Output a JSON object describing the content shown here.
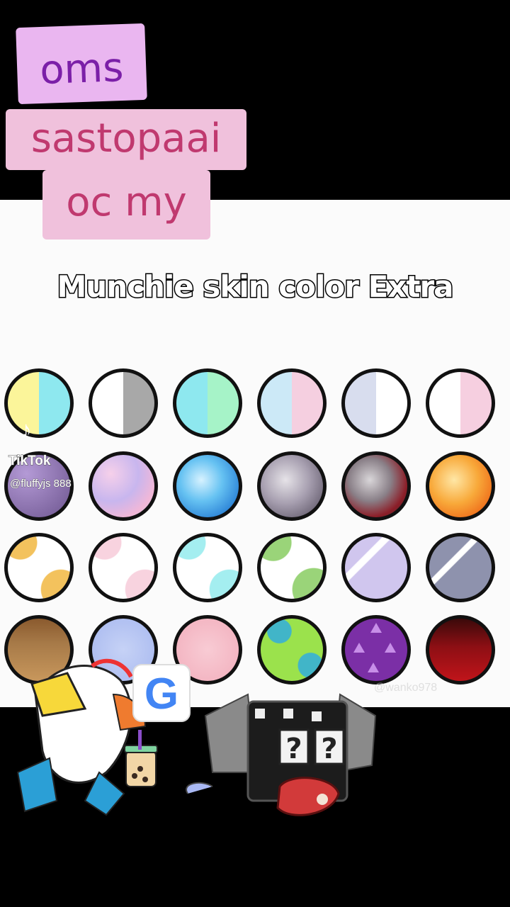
{
  "overlay": {
    "tag_line1": "oms",
    "tag_line2": "sastopaai",
    "tag_line3": "oc my"
  },
  "caption": "Munchie skin color Extra",
  "tiktok": {
    "logo_icon": "tiktok-logo-icon",
    "brand": "TikTok",
    "handle": "@fluffyjs  888"
  },
  "watermark": "@wanko978",
  "swatches": [
    [
      "yellow-cyan",
      "white-gray",
      "cyan-mint",
      "lightblue-pink",
      "lavender-white",
      "white-pink"
    ],
    [
      "purple-sparkle",
      "pastel-clouds",
      "blue-clouds",
      "gray-clouds",
      "red-gray-clouds",
      "orange-fire"
    ],
    [
      "yellow-spots",
      "pink-spots",
      "cyan-spots",
      "green-spots",
      "lavender-streaks",
      "slate-streaks"
    ],
    [
      "chocolate-drip",
      "blue-swirls",
      "pink-hearts",
      "lime-spots",
      "purple-triangles",
      "red-drip"
    ]
  ]
}
